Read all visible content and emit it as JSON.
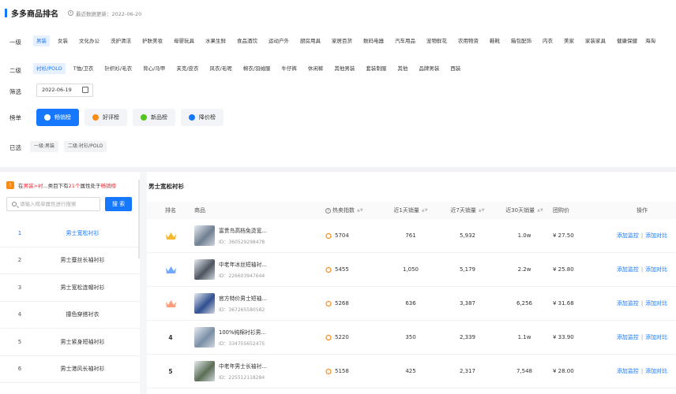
{
  "header": {
    "title": "多多商品排名",
    "update_text": "最近数据更新：2022-06-20"
  },
  "filters": {
    "level1_label": "一级",
    "level1": [
      "男装",
      "女装",
      "文化办公",
      "洗护清洁",
      "护肤美妆",
      "母婴玩具",
      "水果生鲜",
      "食品酒饮",
      "运动户外",
      "厨房用具",
      "家居百货",
      "数码电器",
      "汽车用品",
      "宠物鲜花",
      "农用物资",
      "鞋靴",
      "箱包配饰",
      "内衣",
      "美家",
      "家装家具",
      "健康保健",
      "海淘"
    ],
    "level1_active": 0,
    "level2_label": "二级",
    "level2": [
      "衬衫/POLO",
      "T恤/卫衣",
      "针织衫/毛衣",
      "背心/马甲",
      "夹克/皮衣",
      "风衣/毛呢",
      "棉衣/羽绒服",
      "牛仔裤",
      "休闲裤",
      "其他男装",
      "套装制服",
      "其他",
      "品牌男装",
      "西装"
    ],
    "level2_active": 0,
    "screen_label": "筛选",
    "date_value": "2022-06-19",
    "board_label": "榜单",
    "boards": [
      "畅销榜",
      "好评榜",
      "新品榜",
      "降价榜"
    ],
    "board_active": 0,
    "board_colors": [
      "#1677ff",
      "#fa8c16",
      "#52c41a",
      "#1677ff"
    ],
    "selected_label": "已选",
    "selected": [
      "一级:男装",
      "二级:衬衫/POLO"
    ]
  },
  "left": {
    "notice_pre": "在",
    "notice_cat": "男装>衬...",
    "notice_mid": " 类目下有",
    "notice_count": "21个",
    "notice_mid2": "属性处于",
    "notice_board": "畅销榜",
    "search_placeholder": "请输入榜单属性进行搜索",
    "search_button": "搜 索",
    "items": [
      {
        "num": "1",
        "name": "男士宽松衬衫"
      },
      {
        "num": "2",
        "name": "男士蚕丝长袖衬衫"
      },
      {
        "num": "3",
        "name": "男士宽松连帽衬衫"
      },
      {
        "num": "4",
        "name": "撞色穿搭衬衣"
      },
      {
        "num": "5",
        "name": "男士紧身短袖衬衫"
      },
      {
        "num": "6",
        "name": "男士港风长袖衬衫"
      }
    ],
    "active_index": 0
  },
  "table": {
    "title": "男士宽松衬衫",
    "columns": [
      "排名",
      "商品",
      "热卖指数",
      "近1天销量",
      "近7天销量",
      "近30天销量",
      "团购价",
      "操作"
    ],
    "rows": [
      {
        "rank": "1",
        "name": "富贵鸟高档免烫宽...",
        "id": "ID：360529298478",
        "hot": "5704",
        "d1": "761",
        "d7": "5,932",
        "d30": "1.0w",
        "price": "¥ 27.50"
      },
      {
        "rank": "2",
        "name": "中老年冰丝短袖衬...",
        "id": "ID：226603947644",
        "hot": "5455",
        "d1": "1,050",
        "d7": "5,179",
        "d30": "2.2w",
        "price": "¥ 25.80"
      },
      {
        "rank": "3",
        "name": "官方特价男士短袖...",
        "id": "ID：367265580582",
        "hot": "5268",
        "d1": "636",
        "d7": "3,387",
        "d30": "6,256",
        "price": "¥ 31.68"
      },
      {
        "rank": "4",
        "name": "100%纯棉衬衫男...",
        "id": "ID：334755652475",
        "hot": "5220",
        "d1": "350",
        "d7": "2,339",
        "d30": "1.1w",
        "price": "¥ 33.90"
      },
      {
        "rank": "5",
        "name": "中老年男士长袖衬...",
        "id": "ID：225512118284",
        "hot": "5158",
        "d1": "425",
        "d7": "2,317",
        "d30": "7,548",
        "price": "¥ 28.00"
      }
    ],
    "op_monitor": "添加监控",
    "op_compare": "添加对比",
    "crown_colors": [
      "#f5b82e",
      "#6fa8ff",
      "#ff9c7a"
    ],
    "thumb_colors": [
      "#6f7f91",
      "#4d5560",
      "#2f4f8f",
      "#7a8fa6",
      "#5b6e55"
    ]
  }
}
